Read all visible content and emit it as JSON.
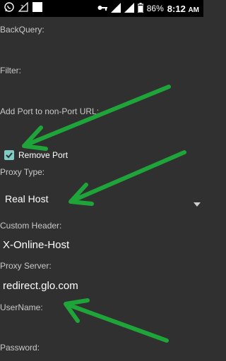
{
  "status_bar": {
    "battery_percent": "86%",
    "time": "8:12",
    "time_suffix": "AM"
  },
  "form": {
    "back_query_label": "BackQuery:",
    "filter_label": "Filter:",
    "add_port_label": "Add Port to non-Port URL:",
    "remove_port_label": "Remove Port",
    "remove_port_checked": true,
    "proxy_type_label": "Proxy Type:",
    "proxy_type_value": "Real Host",
    "custom_header_label": "Custom Header:",
    "custom_header_value": "X-Online-Host",
    "proxy_server_label": "Proxy Server:",
    "proxy_server_value": "redirect.glo.com",
    "username_label": "UserName:",
    "password_label": "Password:"
  },
  "colors": {
    "accent": "#80cbc4",
    "annotation_arrow": "#1fa43a",
    "background": "#303030"
  }
}
